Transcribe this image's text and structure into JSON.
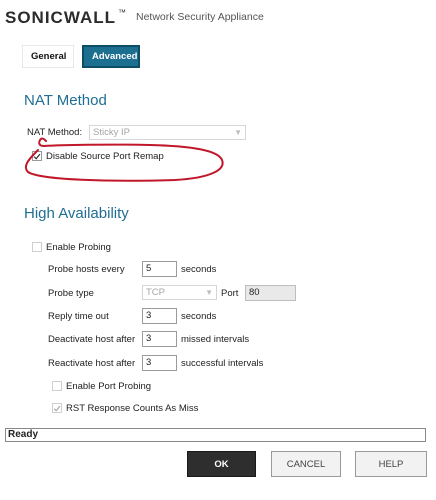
{
  "header": {
    "brand": "SONICWALL",
    "trademark": "™",
    "app_name": "Network Security Appliance"
  },
  "tabs": [
    {
      "label": "General",
      "active": false
    },
    {
      "label": "Advanced",
      "active": true
    }
  ],
  "nat": {
    "section_title": "NAT Method",
    "method_label": "NAT Method:",
    "method_value": "Sticky IP",
    "disable_remap_label": "Disable Source Port Remap",
    "disable_remap_checked": true
  },
  "ha": {
    "section_title": "High Availability",
    "enable_probing_label": "Enable Probing",
    "enable_probing_checked": false,
    "probe_hosts_every_label": "Probe hosts every",
    "probe_hosts_every_value": "5",
    "probe_hosts_every_unit": "seconds",
    "probe_type_label": "Probe type",
    "probe_type_value": "TCP",
    "port_label": "Port",
    "port_value": "80",
    "reply_time_out_label": "Reply time out",
    "reply_time_out_value": "3",
    "reply_time_out_unit": "seconds",
    "deactivate_label": "Deactivate host after",
    "deactivate_value": "3",
    "deactivate_unit": "missed intervals",
    "reactivate_label": "Reactivate host after",
    "reactivate_value": "3",
    "reactivate_unit": "successful intervals",
    "enable_port_probing_label": "Enable Port Probing",
    "enable_port_probing_checked": false,
    "rst_label": "RST Response Counts As Miss",
    "rst_checked": true
  },
  "status": {
    "text": "Ready"
  },
  "buttons": {
    "ok": "OK",
    "cancel": "CANCEL",
    "help": "HELP"
  },
  "colors": {
    "accent": "#1f6e93",
    "active_tab": "#1d6f8f",
    "annotation": "#c0182a"
  }
}
